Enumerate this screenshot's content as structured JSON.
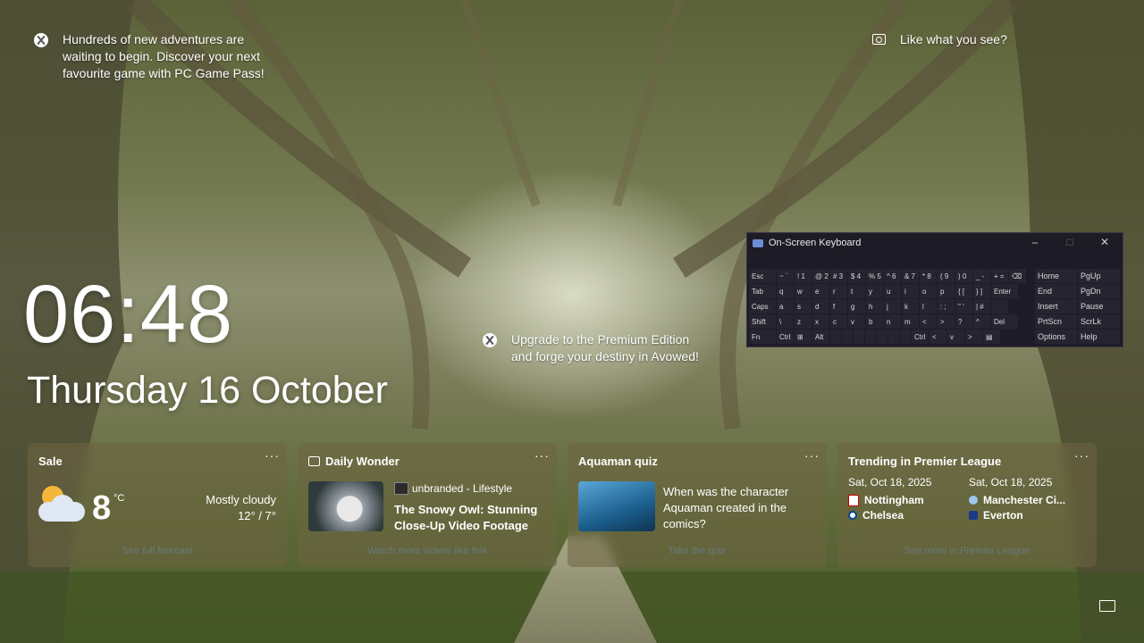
{
  "notifications": {
    "gamepass": "Hundreds of new adventures are waiting to begin. Discover your next favourite game with PC Game Pass!",
    "spotlight": "Like what you see?",
    "premium": "Upgrade to the Premium Edition and forge your destiny in Avowed!"
  },
  "lock": {
    "time": "06:48",
    "date": "Thursday 16 October"
  },
  "weather": {
    "title": "Sale",
    "temp": "8",
    "unit": "°C",
    "condition": "Mostly cloudy",
    "range": "12° / 7°",
    "link": "See full forecast",
    "icon": "partly-cloudy-night-icon"
  },
  "wonder": {
    "title": "Daily Wonder",
    "source": "unbranded - Lifestyle",
    "headline": "The Snowy Owl: Stunning Close-Up Video Footage",
    "link": "Watch more videos like this"
  },
  "quiz": {
    "title": "Aquaman quiz",
    "question": "When was the character Aquaman created in the comics?",
    "link": "Take the quiz"
  },
  "league": {
    "title": "Trending in Premier League",
    "matches": [
      {
        "date": "Sat, Oct 18, 2025",
        "home": "Nottingham",
        "away": "Chelsea"
      },
      {
        "date": "Sat, Oct 18, 2025",
        "home": "Manchester Ci...",
        "away": "Everton"
      }
    ],
    "link": "See more in Premier League"
  },
  "osk": {
    "title": "On-Screen Keyboard",
    "rows": [
      [
        "Esc",
        "~ `",
        "! 1",
        "@ 2",
        "# 3",
        "$ 4",
        "% 5",
        "^ 6",
        "& 7",
        "* 8",
        "( 9",
        ") 0",
        "_ -",
        "+ =",
        "⌫"
      ],
      [
        "Tab",
        "q",
        "w",
        "e",
        "r",
        "t",
        "y",
        "u",
        "i",
        "o",
        "p",
        "{ [",
        "} ]",
        "Enter"
      ],
      [
        "Caps",
        "a",
        "s",
        "d",
        "f",
        "g",
        "h",
        "j",
        "k",
        "l",
        ": ;",
        "\" '",
        "| #",
        ""
      ],
      [
        "Shift",
        "\\",
        "z",
        "x",
        "c",
        "v",
        "b",
        "n",
        "m",
        "<",
        ">",
        "?",
        "^",
        "Del"
      ],
      [
        "Fn",
        "Ctrl",
        "⊞",
        "Alt",
        "",
        "",
        "",
        "",
        "",
        "",
        "",
        "Ctrl",
        "<",
        "v",
        ">",
        "▤"
      ]
    ],
    "side": [
      [
        "Home",
        "PgUp"
      ],
      [
        "End",
        "PgDn"
      ],
      [
        "Insert",
        "Pause"
      ],
      [
        "PrtScn",
        "ScrLk"
      ],
      [
        "Options",
        "Help"
      ]
    ]
  },
  "colors": {
    "osk_bg": "#1d1b25",
    "card_bg": "#6e6441"
  }
}
